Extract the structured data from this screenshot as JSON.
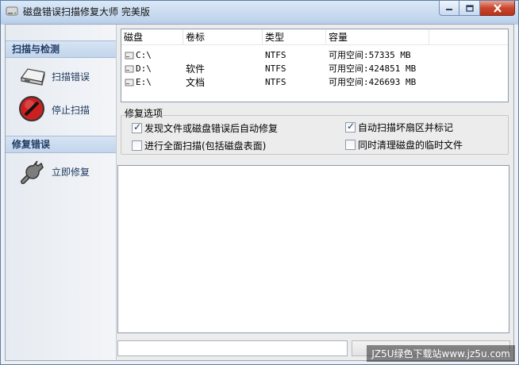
{
  "window": {
    "title": "磁盘错误扫描修复大师 完美版"
  },
  "sidebar": {
    "sections": [
      {
        "title": "扫描与检测",
        "items": [
          {
            "label": "扫描错误",
            "icon": "disk-scan-icon"
          },
          {
            "label": "停止扫描",
            "icon": "stop-icon"
          }
        ]
      },
      {
        "title": "修复错误",
        "items": [
          {
            "label": "立即修复",
            "icon": "wrench-icon"
          }
        ]
      }
    ]
  },
  "disk_table": {
    "columns": [
      "磁盘",
      "卷标",
      "类型",
      "容量"
    ],
    "rows": [
      {
        "drive": "C:\\",
        "label": "",
        "type": "NTFS",
        "capacity": "可用空间:57335 MB"
      },
      {
        "drive": "D:\\",
        "label": "软件",
        "type": "NTFS",
        "capacity": "可用空间:424851 MB"
      },
      {
        "drive": "E:\\",
        "label": "文档",
        "type": "NTFS",
        "capacity": "可用空间:426693 MB"
      }
    ]
  },
  "repair_options": {
    "title": "修复选项",
    "options": [
      {
        "label": "发现文件或磁盘错误后自动修复",
        "checked": true
      },
      {
        "label": "进行全面扫描(包括磁盘表面)",
        "checked": false
      },
      {
        "label": "自动扫描坏扇区并标记",
        "checked": true
      },
      {
        "label": "同时清理磁盘的临时文件",
        "checked": false
      }
    ]
  },
  "watermark": "JZ5U绿色下载站www.jz5u.com",
  "colors": {
    "accent": "#1f3b64",
    "header_bg": "#c2d5ec",
    "stop_red": "#cc1f1f"
  }
}
